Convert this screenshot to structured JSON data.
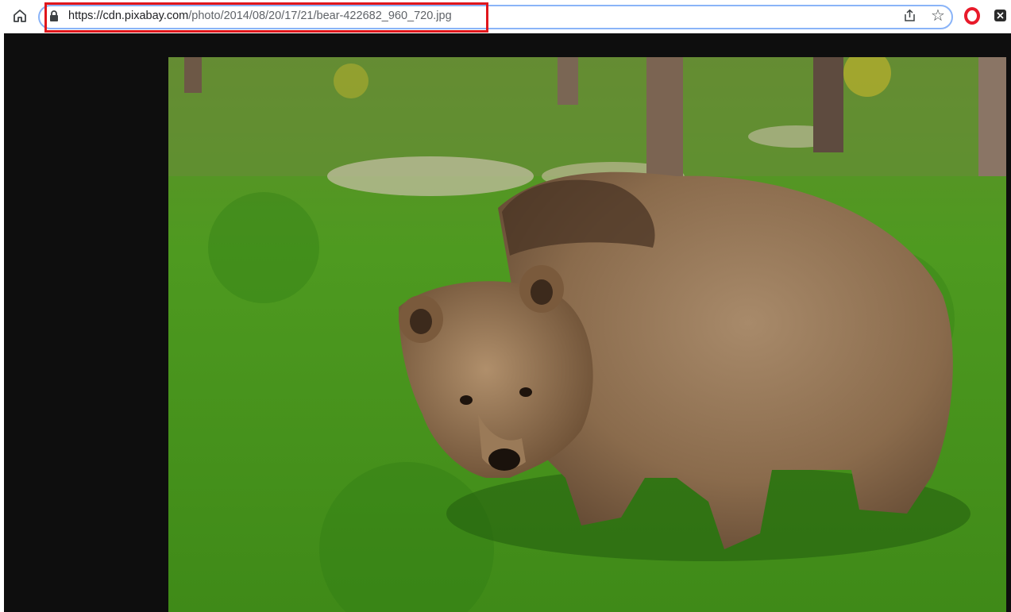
{
  "browser": {
    "url_host": "https://cdn.pixabay.com",
    "url_path": "/photo/2014/08/20/17/21/bear-422682_960_720.jpg"
  },
  "toolbar": {
    "home_icon": "home-icon",
    "lock_icon": "lock-icon",
    "share_icon": "share-icon",
    "bookmark_icon": "star-icon",
    "opera_icon": "opera-icon",
    "extension_icon": "extension-icon"
  },
  "colors": {
    "highlight": "#e0161c",
    "viewer_bg": "#0e0e0e",
    "omnibox_border": "#8ab4f8"
  }
}
